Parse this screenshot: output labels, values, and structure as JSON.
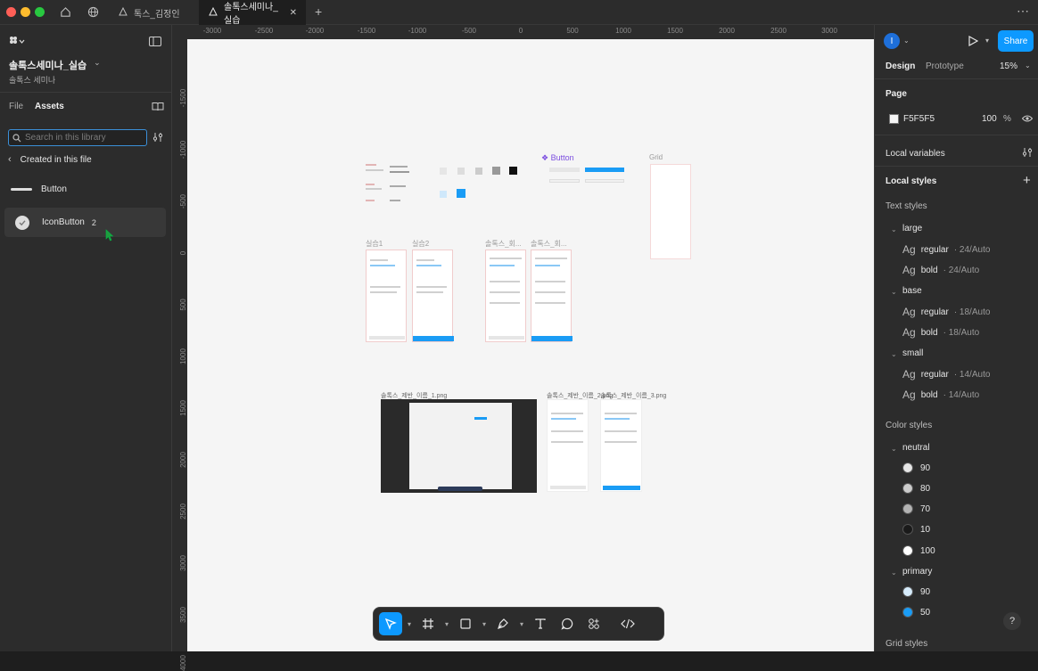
{
  "window": {
    "tabs": [
      {
        "label": "톡스_김정인"
      },
      {
        "label": "솔톡스세미나_실습"
      }
    ],
    "new_tab": "+",
    "more": "⋯"
  },
  "left_panel": {
    "file_name": "솔톡스세미나_실습",
    "project_name": "솔톡스 세미나",
    "tabs": {
      "file": "File",
      "assets": "Assets"
    },
    "search": {
      "placeholder": "Search in this library"
    },
    "section_title": "Created in this file",
    "components": [
      {
        "label": "Button"
      },
      {
        "label": "IconButton",
        "count": "2"
      }
    ]
  },
  "rulers": {
    "top": [
      "-3000",
      "-2500",
      "-2000",
      "-1500",
      "-1000",
      "-500",
      "0",
      "500",
      "1000",
      "1500",
      "2000",
      "2500",
      "3000"
    ],
    "left": [
      "-1500",
      "-1000",
      "-500",
      "0",
      "500",
      "1000",
      "1500",
      "2000",
      "2500",
      "3000",
      "3500",
      "4000"
    ]
  },
  "canvas": {
    "frame_labels": {
      "button": "❖ Button",
      "grid": "Grid",
      "practice1": "실습1",
      "practice2": "실습2",
      "sol1": "솔톡스_회...",
      "sol2": "솔톡스_회...",
      "img1": "솔톡스_제반_이름_1.png",
      "img2": "솔톡스_제반_이름_2.png",
      "img3": "솔톡스_제반_이름_3.png"
    }
  },
  "right_panel": {
    "avatar": "I",
    "share": "Share",
    "tabs": {
      "design": "Design",
      "prototype": "Prototype"
    },
    "zoom": "15%",
    "page": {
      "title": "Page",
      "color": "F5F5F5",
      "opacity": "100",
      "percent": "%"
    },
    "local_variables": "Local variables",
    "local_styles": "Local styles",
    "text_styles": {
      "title": "Text styles",
      "groups": [
        {
          "name": "large",
          "items": [
            {
              "ag": "Ag",
              "label": "regular",
              "meta": "· 24/Auto"
            },
            {
              "ag": "Ag",
              "label": "bold",
              "meta": "· 24/Auto"
            }
          ]
        },
        {
          "name": "base",
          "items": [
            {
              "ag": "Ag",
              "label": "regular",
              "meta": "· 18/Auto"
            },
            {
              "ag": "Ag",
              "label": "bold",
              "meta": "· 18/Auto"
            }
          ]
        },
        {
          "name": "small",
          "items": [
            {
              "ag": "Ag",
              "label": "regular",
              "meta": "· 14/Auto"
            },
            {
              "ag": "Ag",
              "label": "bold",
              "meta": "· 14/Auto"
            }
          ]
        }
      ]
    },
    "color_styles": {
      "title": "Color styles",
      "groups": [
        {
          "name": "neutral",
          "items": [
            {
              "label": "90",
              "color": "#e6e6e6"
            },
            {
              "label": "80",
              "color": "#cccccc"
            },
            {
              "label": "70",
              "color": "#b3b3b3"
            },
            {
              "label": "10",
              "color": "#1a1a1a"
            },
            {
              "label": "100",
              "color": "#ffffff"
            }
          ]
        },
        {
          "name": "primary",
          "items": [
            {
              "label": "90",
              "color": "#d6ecfc"
            },
            {
              "label": "50",
              "color": "#1a9cf5"
            }
          ]
        }
      ]
    },
    "grid_styles": "Grid styles",
    "help": "?"
  },
  "colors": {
    "accent": "#0d99ff",
    "panel": "#2c2c2c",
    "canvas": "#f5f5f5"
  }
}
